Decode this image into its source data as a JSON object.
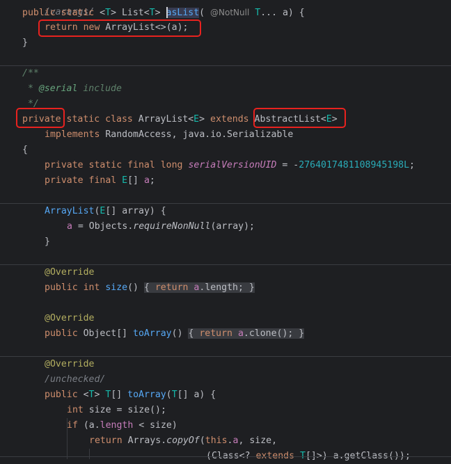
{
  "editor": {
    "top_comment": "/varargs/",
    "l1": {
      "a": "public",
      "b": " static ",
      "c": "<",
      "d": "T",
      "e": "> List<",
      "f": "T",
      "g": "> ",
      "h": "asList",
      "i": "( ",
      "hint": "@NotNull",
      "j": " ",
      "k": "T",
      "l": "... a) {"
    },
    "l2": {
      "a": "return",
      "b": " ",
      "c": "new",
      "d": " ArrayList<>(a);"
    },
    "l3": "}",
    "l4": "/**",
    "l5": {
      "a": " * ",
      "b": "@serial",
      "c": " include"
    },
    "l6": " */",
    "l7": {
      "a": "private",
      "b": " ",
      "c": "static",
      "d": " ",
      "e": "class",
      "f": " ArrayList<",
      "g": "E",
      "h": "> ",
      "i": "extends",
      "j": " ",
      "k": "AbstractList<",
      "l": "E",
      "m": ">"
    },
    "l8": {
      "a": "implements",
      "b": " RandomAccess, java.io.Serializable"
    },
    "l9": "{",
    "l10": {
      "a": "private static final long ",
      "b": "serialVersionUID",
      "c": " = -",
      "d": "2764017481108945198L",
      "e": ";"
    },
    "l11": {
      "a": "private final ",
      "b": "E",
      "c": "[] ",
      "d": "a",
      "e": ";"
    },
    "l12": {
      "a": "ArrayList",
      "b": "(",
      "c": "E",
      "d": "[] array) {"
    },
    "l13": {
      "a": "a",
      "b": " = Objects.",
      "c": "requireNonNull",
      "d": "(array);"
    },
    "l14": "}",
    "l15": "@Override",
    "l16": {
      "a": "public int ",
      "b": "size",
      "c": "()",
      "d": " ",
      "e": "{ ",
      "f": "return ",
      "g": "a",
      "h": ".length; ",
      "i": "}"
    },
    "l17": "@Override",
    "l18": {
      "a": "public ",
      "b": "Object[] ",
      "c": "toArray",
      "d": "()",
      "e": " ",
      "f": "{ ",
      "g": "return ",
      "h": "a",
      "i": ".clone(); ",
      "j": "}"
    },
    "l19": "@Override",
    "l20": "/unchecked/",
    "l21": {
      "a": "public ",
      "b": "<",
      "c": "T",
      "d": "> ",
      "e": "T",
      "f": "[] ",
      "g": "toArray",
      "h": "(",
      "i": "T",
      "j": "[] a) {"
    },
    "l22": {
      "a": "int",
      "b": " size = size();"
    },
    "l23": {
      "a": "if",
      "b": " (a.",
      "c": "length",
      "d": " < size)"
    },
    "l24": {
      "a": "return",
      "b": " Arrays.",
      "c": "copyOf",
      "d": "(",
      "e": "this",
      "f": ".",
      "g": "a",
      "h": ", size,"
    },
    "l25": {
      "a": "(Class<? ",
      "b": "extends",
      "c": " ",
      "d": "T",
      "e": "[]>) a.getClass());"
    }
  },
  "colors": {
    "background": "#1e1f22",
    "highlight_box": "#e8221f"
  }
}
